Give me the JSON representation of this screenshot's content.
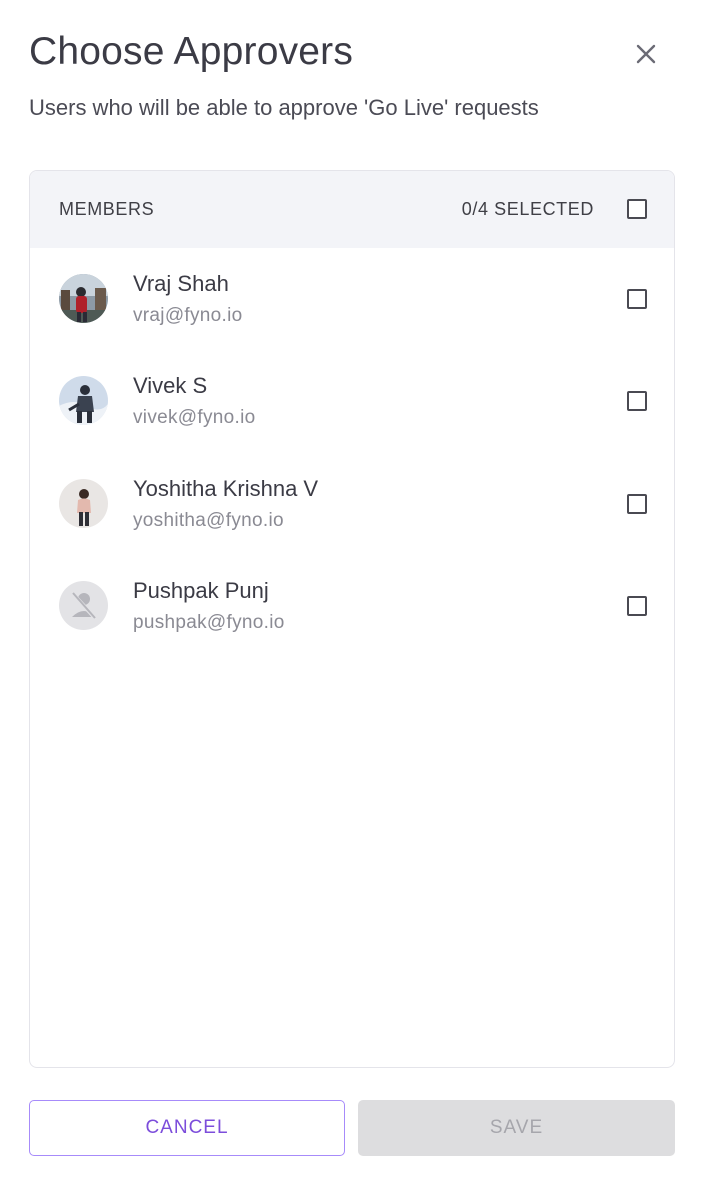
{
  "dialog": {
    "title": "Choose Approvers",
    "subtitle": "Users who will be able to approve 'Go Live' requests",
    "close_icon": "close-icon"
  },
  "members": {
    "header_label": "MEMBERS",
    "selected_text": "0/4 SELECTED",
    "select_all_checked": false,
    "items": [
      {
        "name": "Vraj Shah",
        "email": "vraj@fyno.io",
        "avatar": "photo",
        "checked": false
      },
      {
        "name": "Vivek S",
        "email": "vivek@fyno.io",
        "avatar": "photo",
        "checked": false
      },
      {
        "name": "Yoshitha Krishna V",
        "email": "yoshitha@fyno.io",
        "avatar": "photo",
        "checked": false
      },
      {
        "name": "Pushpak Punj",
        "email": "pushpak@fyno.io",
        "avatar": "no-photo-placeholder",
        "checked": false
      }
    ]
  },
  "footer": {
    "cancel_label": "CANCEL",
    "save_label": "SAVE",
    "save_disabled": true
  },
  "colors": {
    "accent": "#7c4ddb",
    "accent_border": "#a78bfa",
    "header_bg": "#f3f4f8",
    "disabled_bg": "#dddddf",
    "disabled_text": "#a6a6ac"
  }
}
